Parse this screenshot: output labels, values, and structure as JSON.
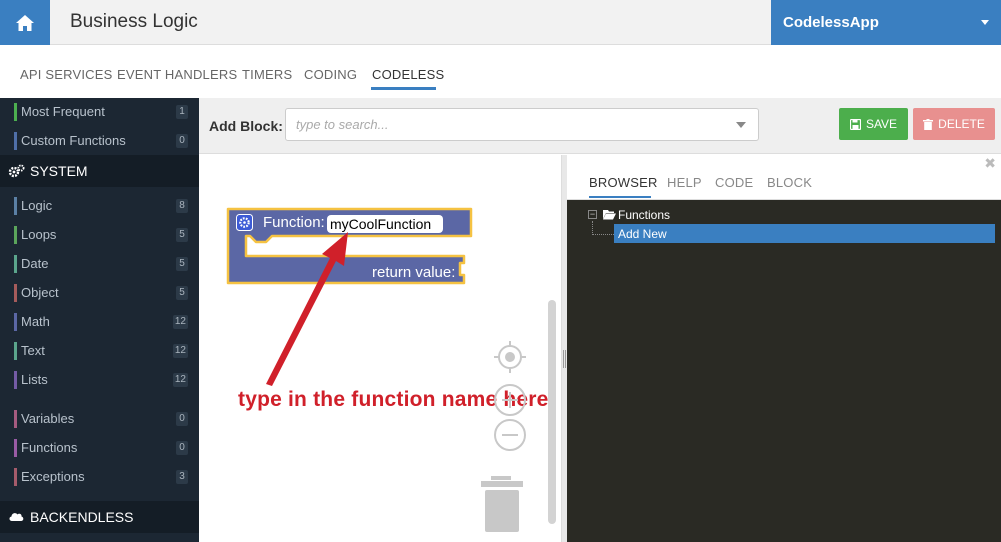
{
  "header": {
    "title": "Business Logic",
    "app_name": "CodelessApp"
  },
  "tabs": [
    {
      "label": "API SERVICES"
    },
    {
      "label": "EVENT HANDLERS"
    },
    {
      "label": "TIMERS"
    },
    {
      "label": "CODING"
    },
    {
      "label": "CODELESS",
      "active": true
    }
  ],
  "sidebar": {
    "top_items": [
      {
        "label": "Most Frequent",
        "count": "1",
        "color": "#4caf50"
      },
      {
        "label": "Custom Functions",
        "count": "0",
        "color": "#4f6fa8"
      }
    ],
    "system_title": "SYSTEM",
    "system_items": [
      {
        "label": "Logic",
        "count": "8",
        "color": "#5b80a5"
      },
      {
        "label": "Loops",
        "count": "5",
        "color": "#5ba55b"
      },
      {
        "label": "Date",
        "count": "5",
        "color": "#5ba58c"
      },
      {
        "label": "Object",
        "count": "5",
        "color": "#a55b5b"
      },
      {
        "label": "Math",
        "count": "12",
        "color": "#5b67a5"
      },
      {
        "label": "Text",
        "count": "12",
        "color": "#5ba58c"
      },
      {
        "label": "Lists",
        "count": "12",
        "color": "#745ba5"
      }
    ],
    "vars_items": [
      {
        "label": "Variables",
        "count": "0",
        "color": "#a55b80"
      },
      {
        "label": "Functions",
        "count": "0",
        "color": "#995ba5"
      },
      {
        "label": "Exceptions",
        "count": "3",
        "color": "#a55b6b"
      }
    ],
    "backendless_title": "BACKENDLESS"
  },
  "toolbar": {
    "add_block_label": "Add Block:",
    "search_placeholder": "type to search...",
    "save_label": "SAVE",
    "delete_label": "DELETE"
  },
  "block": {
    "function_label": "Function:",
    "function_name": "myCoolFunction",
    "return_label": "return value:",
    "color": "#5b67a5",
    "highlight": "#f5c242"
  },
  "annotation": {
    "text": "type in the function name here",
    "color": "#d0202a"
  },
  "panel": {
    "tabs": [
      {
        "label": "BROWSER",
        "active": true
      },
      {
        "label": "HELP"
      },
      {
        "label": "CODE"
      },
      {
        "label": "BLOCK"
      }
    ],
    "tree_root": "Functions",
    "tree_selected": "Add New"
  }
}
